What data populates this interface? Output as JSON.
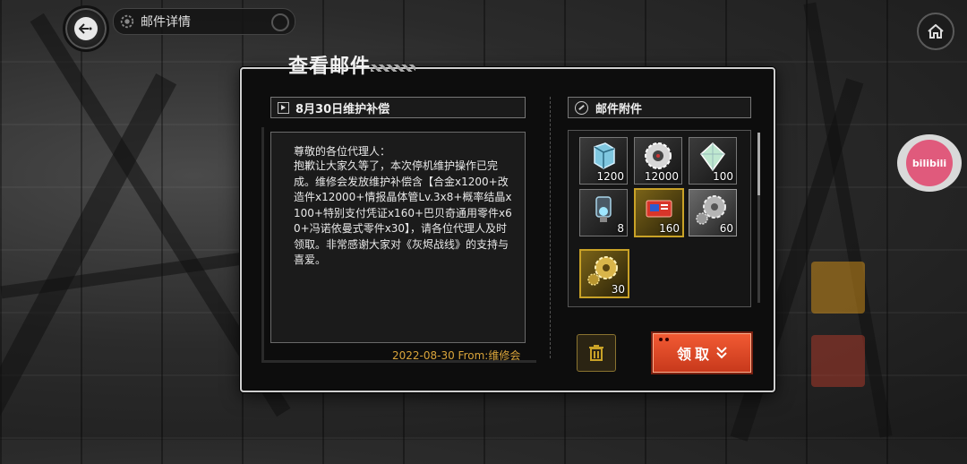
{
  "topbar": {
    "title": "邮件详情"
  },
  "panel": {
    "title": "查看邮件"
  },
  "mail": {
    "subject": "8月30日维护补偿",
    "greeting": "尊敬的各位代理人：",
    "body": "抱歉让大家久等了，本次停机维护操作已完成。维修会发放维护补偿含【合金x1200+改造件x12000+情报晶体管Lv.3x8+概率结晶x100+特别支付凭证x160+巴贝奇通用零件x60+冯诺依曼式零件x30】，请各位代理人及时领取。非常感谢大家对《灰烬战线》的支持与喜爱。",
    "footer": "2022-08-30  From:维修会"
  },
  "attachments": {
    "title": "邮件附件",
    "items": [
      {
        "icon": "alloy-cube-icon",
        "count": "1200"
      },
      {
        "icon": "gear-disc-icon",
        "count": "12000"
      },
      {
        "icon": "crystal-icon",
        "count": "100"
      },
      {
        "icon": "transistor-icon",
        "count": "8"
      },
      {
        "icon": "payment-voucher-icon",
        "count": "160"
      },
      {
        "icon": "babbage-gear-icon",
        "count": "60"
      },
      {
        "icon": "von-neumann-gear-icon",
        "count": "30"
      }
    ]
  },
  "actions": {
    "claim_label": "领取"
  },
  "watermark": {
    "label": "bilibili"
  },
  "colors": {
    "accent_gold": "#d9a43a",
    "claim_red": "#e4482a"
  }
}
